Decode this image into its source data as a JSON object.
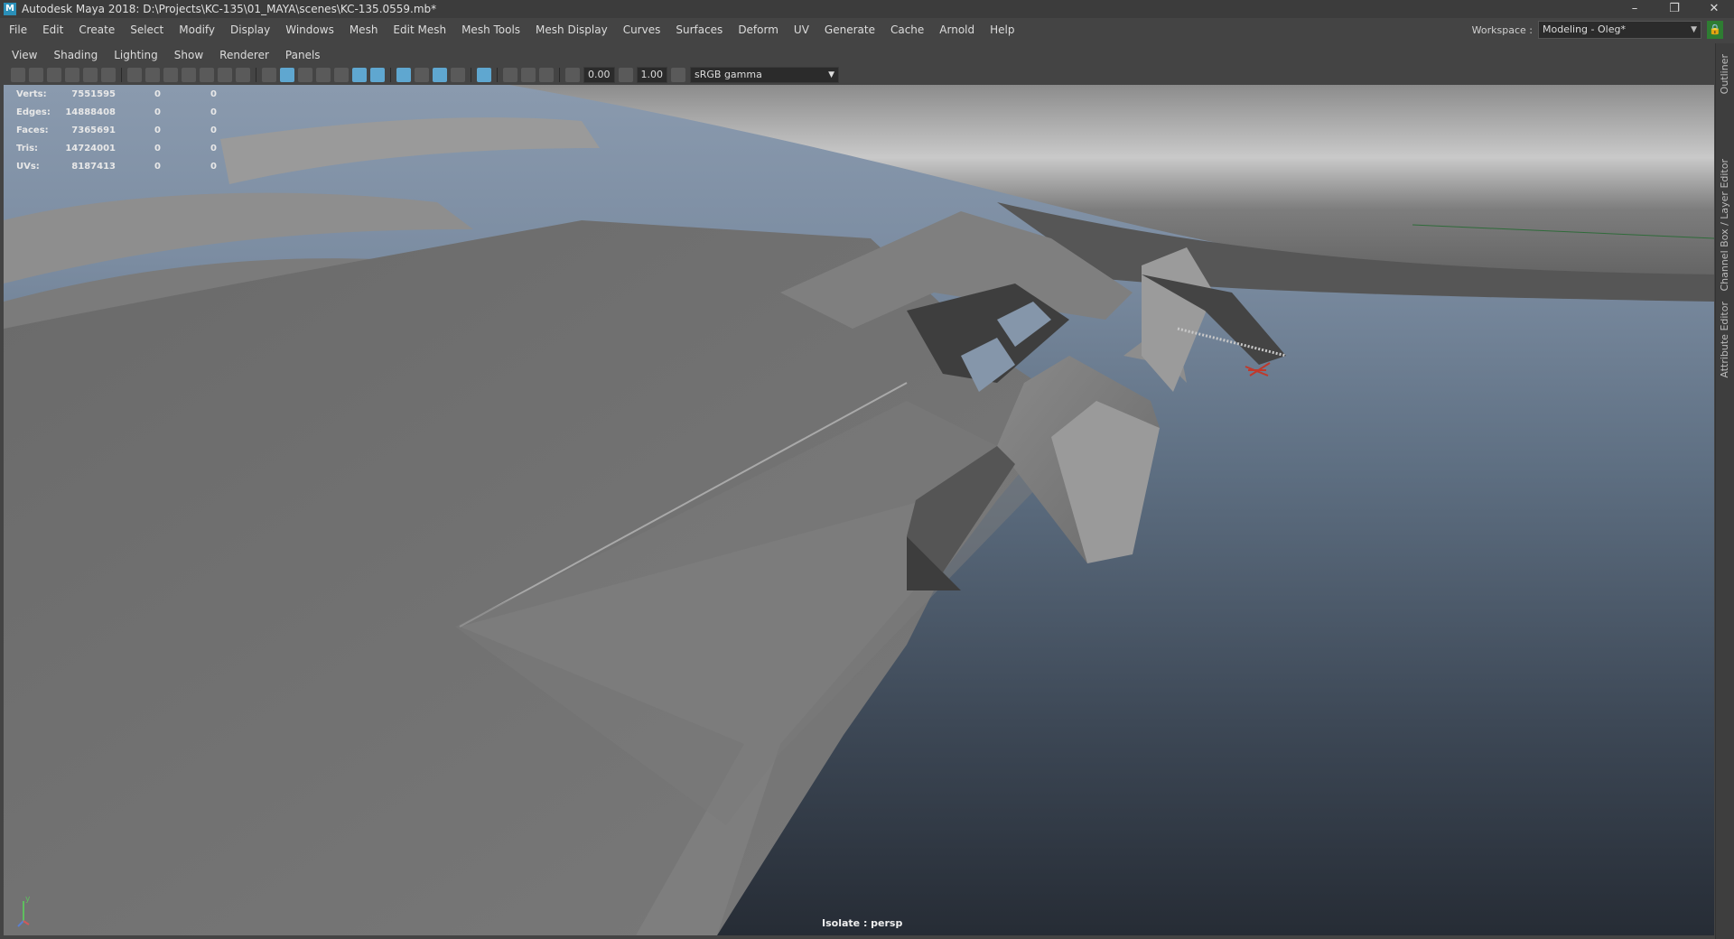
{
  "window": {
    "title": "Autodesk Maya 2018: D:\\Projects\\KC-135\\01_MAYA\\scenes\\KC-135.0559.mb*",
    "app_icon": "M",
    "controls": [
      "–",
      "❐",
      "✕"
    ]
  },
  "menubar": {
    "items": [
      "File",
      "Edit",
      "Create",
      "Select",
      "Modify",
      "Display",
      "Windows",
      "Mesh",
      "Edit Mesh",
      "Mesh Tools",
      "Mesh Display",
      "Curves",
      "Surfaces",
      "Deform",
      "UV",
      "Generate",
      "Cache",
      "Arnold",
      "Help"
    ]
  },
  "workspace": {
    "label": "Workspace :",
    "value": "Modeling - Oleg*"
  },
  "side_tabs": [
    "Outliner",
    "Channel Box / Layer Editor",
    "Attribute Editor"
  ],
  "panel_menu": {
    "items": [
      "View",
      "Shading",
      "Lighting",
      "Show",
      "Renderer",
      "Panels"
    ]
  },
  "panel_toolbar": {
    "exposure": "0.00",
    "gamma": "1.00",
    "colorspace": "sRGB gamma"
  },
  "hud": {
    "rows": [
      {
        "label": "Verts:",
        "value": "7551595",
        "selected": "0",
        "component": "0"
      },
      {
        "label": "Edges:",
        "value": "14888408",
        "selected": "0",
        "component": "0"
      },
      {
        "label": "Faces:",
        "value": "7365691",
        "selected": "0",
        "component": "0"
      },
      {
        "label": "Tris:",
        "value": "14724001",
        "selected": "0",
        "component": "0"
      },
      {
        "label": "UVs:",
        "value": "8187413",
        "selected": "0",
        "component": "0"
      }
    ]
  },
  "viewport": {
    "camera_label": "Isolate : persp",
    "axis": "y"
  },
  "colors": {
    "selection_accent": "#5fa7d0",
    "lock_green": "#2e7d32",
    "locator_red": "#c0392b"
  }
}
